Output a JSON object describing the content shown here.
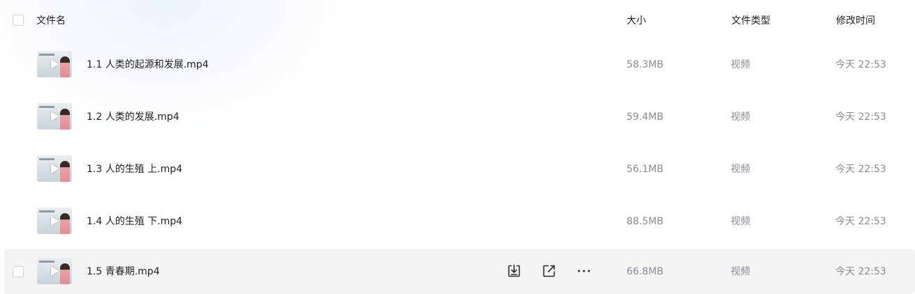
{
  "header": {
    "name_label": "文件名",
    "size_label": "大小",
    "type_label": "文件类型",
    "time_label": "修改时间"
  },
  "files": [
    {
      "name": "1.1 人类的起源和发展.mp4",
      "size": "58.3MB",
      "type": "视频",
      "modified": "今天 22:53"
    },
    {
      "name": "1.2 人类的发展.mp4",
      "size": "59.4MB",
      "type": "视频",
      "modified": "今天 22:53"
    },
    {
      "name": "1.3 人的生殖 上.mp4",
      "size": "56.1MB",
      "type": "视频",
      "modified": "今天 22:53"
    },
    {
      "name": "1.4 人的生殖 下.mp4",
      "size": "88.5MB",
      "type": "视频",
      "modified": "今天 22:53"
    },
    {
      "name": "1.5 青春期.mp4",
      "size": "66.8MB",
      "type": "视频",
      "modified": "今天 22:53"
    }
  ],
  "icons": {
    "download": "download-icon",
    "share": "share-icon",
    "more": "more-icon",
    "play": "play-icon"
  },
  "colors": {
    "hover_row": "#f4f4f5",
    "muted_text": "#888c93",
    "primary_text": "#1f1f1f"
  }
}
